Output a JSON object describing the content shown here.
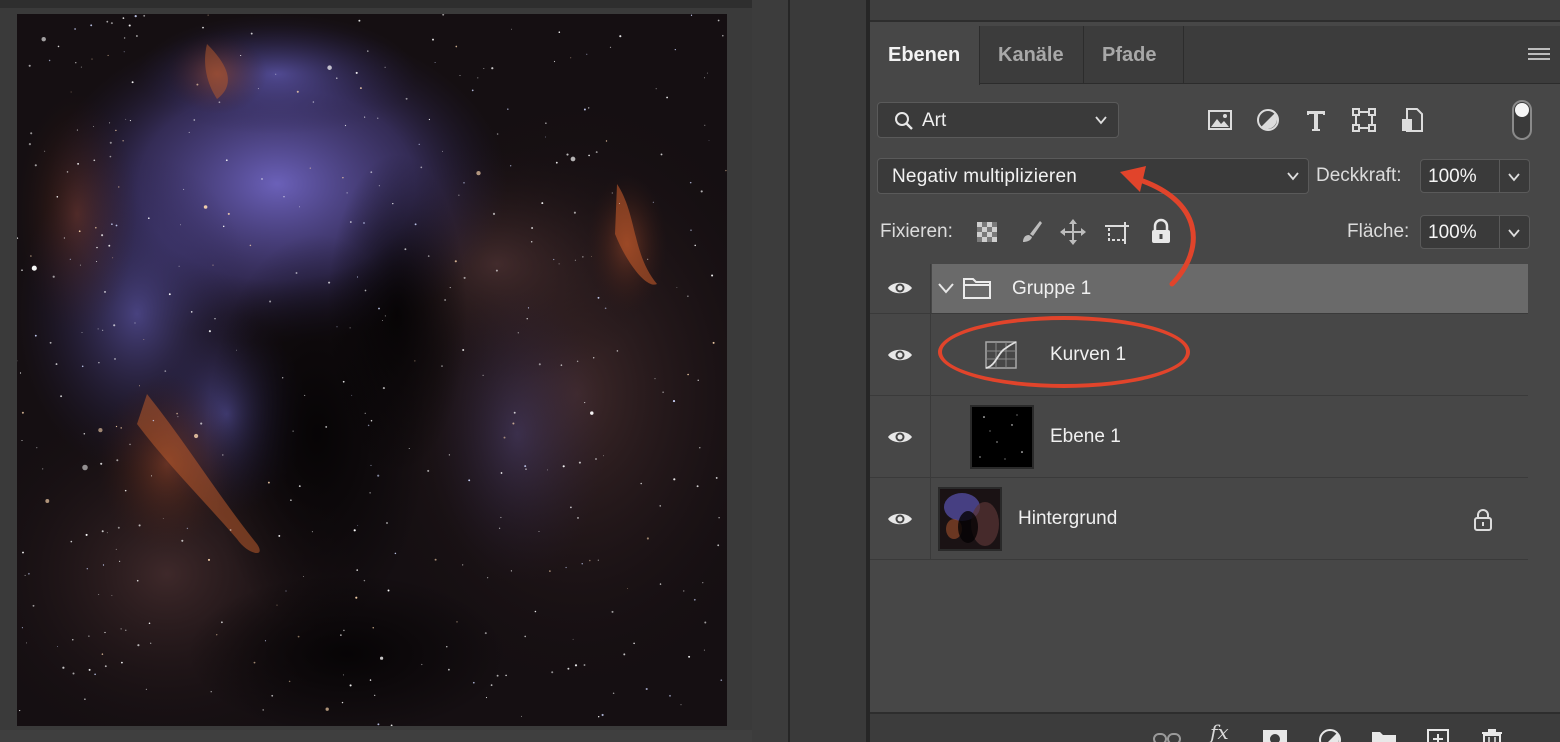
{
  "tabs": [
    {
      "label": "Ebenen",
      "active": true
    },
    {
      "label": "Kanäle",
      "active": false
    },
    {
      "label": "Pfade",
      "active": false
    }
  ],
  "filter": {
    "kind_label": "Art",
    "icons": [
      "image-filter-icon",
      "adjustment-filter-icon",
      "type-filter-icon",
      "shape-filter-icon",
      "smart-object-filter-icon"
    ]
  },
  "blend": {
    "mode": "Negativ multiplizieren",
    "opacity_label": "Deckkraft:",
    "opacity_value": "100%"
  },
  "lock": {
    "label": "Fixieren:",
    "fill_label": "Fläche:",
    "fill_value": "100%"
  },
  "layers": [
    {
      "name": "Gruppe 1",
      "type": "group",
      "visible": true,
      "selected": true
    },
    {
      "name": "Kurven 1",
      "type": "curves-adjustment",
      "visible": true,
      "selected": false
    },
    {
      "name": "Ebene 1",
      "type": "pixel",
      "visible": true,
      "selected": false
    },
    {
      "name": "Hintergrund",
      "type": "background",
      "visible": true,
      "selected": false,
      "locked": true
    }
  ],
  "annotation_color": "#e1442b",
  "bottom_icons": [
    "link-layers-icon",
    "fx-icon",
    "add-mask-icon",
    "new-adjustment-icon",
    "new-group-icon",
    "new-layer-icon",
    "delete-layer-icon"
  ]
}
